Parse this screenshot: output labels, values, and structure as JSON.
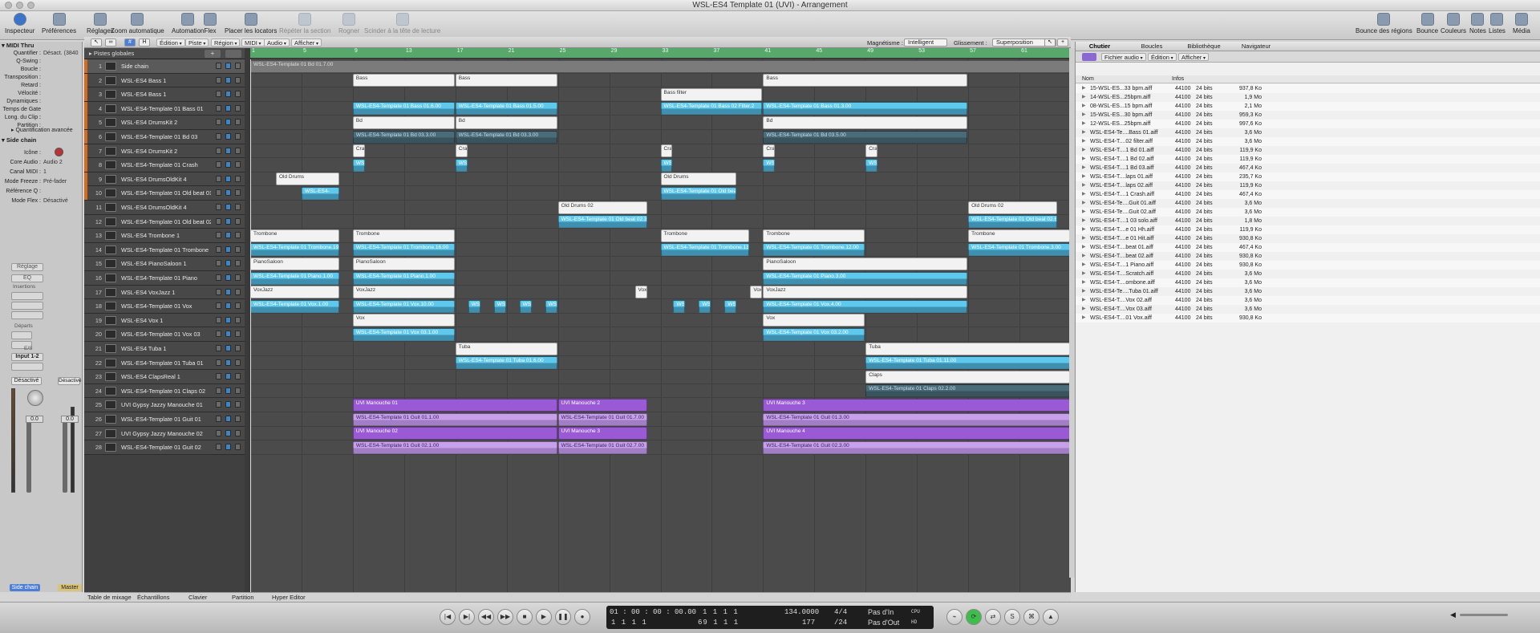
{
  "window": {
    "title": "WSL-ES4 Template 01 (UVI) - Arrangement"
  },
  "toolbar": {
    "left": [
      {
        "label": "Inspecteur",
        "icon": "info-icon"
      },
      {
        "label": "Préférences",
        "icon": "preferences-icon"
      },
      {
        "label": "Réglages",
        "icon": "settings-icon"
      },
      {
        "label": "Zoom automatique",
        "icon": "zoom-icon"
      },
      {
        "label": "Automation",
        "icon": "automation-icon"
      },
      {
        "label": "Flex",
        "icon": "flex-icon"
      },
      {
        "label": "Placer les locators",
        "icon": "locators-icon"
      },
      {
        "label": "Répéter la section",
        "icon": "repeat-icon"
      },
      {
        "label": "Rogner",
        "icon": "crop-icon"
      },
      {
        "label": "Scinder à la tête de lecture",
        "icon": "split-icon"
      }
    ],
    "right": [
      {
        "label": "Bounce des régions",
        "icon": "bounce-regions-icon"
      },
      {
        "label": "Bounce",
        "icon": "bounce-icon"
      },
      {
        "label": "Couleurs",
        "icon": "colors-icon"
      },
      {
        "label": "Notes",
        "icon": "notes-icon"
      },
      {
        "label": "Listes",
        "icon": "lists-icon"
      },
      {
        "label": "Média",
        "icon": "media-icon"
      }
    ]
  },
  "inspector": {
    "region_header": "MIDI Thru",
    "params": [
      {
        "k": "Quantifier :",
        "v": "Désact. (3840"
      },
      {
        "k": "Q-Swing :",
        "v": ""
      },
      {
        "k": "Boucle :",
        "v": ""
      },
      {
        "k": "Transposition :",
        "v": ""
      },
      {
        "k": "Retard :",
        "v": ""
      },
      {
        "k": "Vélocité :",
        "v": ""
      },
      {
        "k": "Dynamiques :",
        "v": ""
      },
      {
        "k": "Temps de Gate :",
        "v": ""
      },
      {
        "k": "Long. du Clip :",
        "v": ""
      },
      {
        "k": "Partition :",
        "v": ""
      }
    ],
    "advanced": "Quantification avancée",
    "track_header": "Side chain",
    "track_params": [
      {
        "k": "Icône :",
        "v": ""
      },
      {
        "k": "Core Audio :",
        "v": "Audio 2"
      },
      {
        "k": "Canal MIDI :",
        "v": "1"
      },
      {
        "k": "Mode Freeze :",
        "v": "Pré-fader"
      },
      {
        "k": "Référence Q :",
        "v": ""
      },
      {
        "k": "Mode Flex :",
        "v": "Désactivé"
      }
    ],
    "strip": {
      "reglage": "Réglage",
      "eq": "EQ",
      "insertions": "Insertions",
      "departs": "Départs",
      "es": "E/S",
      "input": "Input 1-2",
      "desactive": "Désactivé",
      "desactive2": "Désactivé",
      "vol1": "0.0",
      "vol2": "0.0",
      "name1": "Side chain",
      "name2": "Master"
    }
  },
  "arrange_menu": {
    "edition": "Édition",
    "piste": "Piste",
    "region": "Région",
    "midi": "MIDI",
    "audio": "Audio",
    "afficher": "Afficher",
    "magnetisme_label": "Magnétisme :",
    "magnetisme": "Intelligent",
    "glissement_label": "Glissement :",
    "glissement": "Superposition"
  },
  "global_tracks": "Pistes globales",
  "ruler": [
    "1",
    "5",
    "9",
    "13",
    "17",
    "21",
    "25",
    "29",
    "33",
    "37",
    "41",
    "45",
    "49",
    "53",
    "57",
    "61"
  ],
  "tracks": [
    {
      "n": "1",
      "name": "Side chain"
    },
    {
      "n": "2",
      "name": "WSL-ES4 Bass 1"
    },
    {
      "n": "3",
      "name": "WSL-ES4 Bass 1"
    },
    {
      "n": "4",
      "name": "WSL-ES4-Template 01 Bass 01"
    },
    {
      "n": "5",
      "name": "WSL-ES4 DrumsKit 2"
    },
    {
      "n": "6",
      "name": "WSL-ES4-Template 01 Bd 03"
    },
    {
      "n": "7",
      "name": "WSL-ES4 DrumsKit 2"
    },
    {
      "n": "8",
      "name": "WSL-ES4-Template 01 Crash"
    },
    {
      "n": "9",
      "name": "WSL-ES4 DrumsOldKit 4"
    },
    {
      "n": "10",
      "name": "WSL-ES4-Template 01 Old beat 01"
    },
    {
      "n": "11",
      "name": "WSL-ES4 DrumsOldKit 4"
    },
    {
      "n": "12",
      "name": "WSL-ES4-Template 01 Old beat 02"
    },
    {
      "n": "13",
      "name": "WSL-ES4 Trombone 1"
    },
    {
      "n": "14",
      "name": "WSL-ES4-Template 01 Trombone"
    },
    {
      "n": "15",
      "name": "WSL-ES4 PianoSaloon 1"
    },
    {
      "n": "16",
      "name": "WSL-ES4-Template 01 Piano"
    },
    {
      "n": "17",
      "name": "WSL-ES4 VoxJazz 1"
    },
    {
      "n": "18",
      "name": "WSL-ES4-Template 01 Vox"
    },
    {
      "n": "19",
      "name": "WSL-ES4 Vox 1"
    },
    {
      "n": "20",
      "name": "WSL-ES4-Template 01 Vox 03"
    },
    {
      "n": "21",
      "name": "WSL-ES4 Tuba 1"
    },
    {
      "n": "22",
      "name": "WSL-ES4-Template 01 Tuba 01"
    },
    {
      "n": "23",
      "name": "WSL-ES4 ClapsReal 1"
    },
    {
      "n": "24",
      "name": "WSL-ES4-Template 01 Claps 02"
    },
    {
      "n": "25",
      "name": "UVI Gypsy Jazzy Manouche 01"
    },
    {
      "n": "26",
      "name": "WSL-ES4-Template 01 Guit 01"
    },
    {
      "n": "27",
      "name": "UVI Gypsy Jazzy Manouche 02"
    },
    {
      "n": "28",
      "name": "WSL-ES4-Template 01 Guit 02"
    }
  ],
  "regions": [
    {
      "row": 0,
      "start": 1,
      "end": 65,
      "c": "wd",
      "t": "WSL-ES4-Template 01 Bd 01.7.00"
    },
    {
      "row": 1,
      "start": 9,
      "end": 17,
      "c": "w",
      "t": "Bass"
    },
    {
      "row": 1,
      "start": 17,
      "end": 25,
      "c": "w",
      "t": "Bass"
    },
    {
      "row": 1,
      "start": 41,
      "end": 57,
      "c": "w",
      "t": "Bass"
    },
    {
      "row": 2,
      "start": 33,
      "end": 41,
      "c": "w",
      "t": "Bass filter"
    },
    {
      "row": 3,
      "start": 9,
      "end": 17,
      "c": "b",
      "t": "WSL-ES4-Template 01 Bass 01.6.00"
    },
    {
      "row": 3,
      "start": 17,
      "end": 25,
      "c": "b",
      "t": "WSL-ES4-Template 01 Bass 01.5.00"
    },
    {
      "row": 3,
      "start": 33,
      "end": 41,
      "c": "b",
      "t": "WSL-ES4-Template 01 Bass 02 Filter.2"
    },
    {
      "row": 3,
      "start": 41,
      "end": 57,
      "c": "b",
      "t": "WSL-ES4-Template 01 Bass 01.3.00"
    },
    {
      "row": 4,
      "start": 9,
      "end": 17,
      "c": "w",
      "t": "Bd"
    },
    {
      "row": 4,
      "start": 17,
      "end": 25,
      "c": "w",
      "t": "Bd"
    },
    {
      "row": 4,
      "start": 41,
      "end": 57,
      "c": "w",
      "t": "Bd"
    },
    {
      "row": 5,
      "start": 9,
      "end": 17,
      "c": "bd",
      "t": "WSL-ES4-Template 01 Bd 03.3.00"
    },
    {
      "row": 5,
      "start": 17,
      "end": 25,
      "c": "bd",
      "t": "WSL-ES4-Template 01 Bd 03.3.00"
    },
    {
      "row": 5,
      "start": 41,
      "end": 57,
      "c": "bd",
      "t": "WSL-ES4-Template 01 Bd 03.5.00"
    },
    {
      "row": 6,
      "start": 9,
      "end": 10,
      "c": "w",
      "t": "Cras"
    },
    {
      "row": 6,
      "start": 17,
      "end": 18,
      "c": "w",
      "t": "Cras"
    },
    {
      "row": 6,
      "start": 33,
      "end": 34,
      "c": "w",
      "t": "Cras"
    },
    {
      "row": 6,
      "start": 41,
      "end": 42,
      "c": "w",
      "t": "Cras"
    },
    {
      "row": 6,
      "start": 49,
      "end": 50,
      "c": "w",
      "t": "Cras"
    },
    {
      "row": 7,
      "start": 9,
      "end": 10,
      "c": "b",
      "t": "WSL"
    },
    {
      "row": 7,
      "start": 17,
      "end": 18,
      "c": "b",
      "t": "WSL"
    },
    {
      "row": 7,
      "start": 33,
      "end": 34,
      "c": "b",
      "t": "WSL"
    },
    {
      "row": 7,
      "start": 41,
      "end": 42,
      "c": "b",
      "t": "WSL"
    },
    {
      "row": 7,
      "start": 49,
      "end": 50,
      "c": "b",
      "t": "WSL"
    },
    {
      "row": 8,
      "start": 3,
      "end": 8,
      "c": "w",
      "t": "Old Drums"
    },
    {
      "row": 8,
      "start": 33,
      "end": 39,
      "c": "w",
      "t": "Old Drums"
    },
    {
      "row": 9,
      "start": 5,
      "end": 8,
      "c": "b",
      "t": "WSL-ES4-"
    },
    {
      "row": 9,
      "start": 33,
      "end": 39,
      "c": "b",
      "t": "WSL-ES4-Template 01 Old beat"
    },
    {
      "row": 10,
      "start": 25,
      "end": 32,
      "c": "w",
      "t": "Old Drums 02"
    },
    {
      "row": 10,
      "start": 57,
      "end": 64,
      "c": "w",
      "t": "Old Drums 02"
    },
    {
      "row": 11,
      "start": 25,
      "end": 32,
      "c": "b",
      "t": "WSL-ES4-Template 01 Old beat 02.3"
    },
    {
      "row": 11,
      "start": 57,
      "end": 64,
      "c": "b",
      "t": "WSL-ES4-Template 01 Old beat 02.6"
    },
    {
      "row": 12,
      "start": 1,
      "end": 8,
      "c": "w",
      "t": "Trombone"
    },
    {
      "row": 12,
      "start": 9,
      "end": 17,
      "c": "w",
      "t": "Trombone"
    },
    {
      "row": 12,
      "start": 33,
      "end": 40,
      "c": "w",
      "t": "Trombone"
    },
    {
      "row": 12,
      "start": 41,
      "end": 49,
      "c": "w",
      "t": "Trombone"
    },
    {
      "row": 12,
      "start": 57,
      "end": 65,
      "c": "w",
      "t": "Trombone"
    },
    {
      "row": 13,
      "start": 1,
      "end": 8,
      "c": "b",
      "t": "WSL-ES4-Template 01 Trombone.19"
    },
    {
      "row": 13,
      "start": 9,
      "end": 17,
      "c": "b",
      "t": "WSL-ES4-Template 01 Trombone.16.00"
    },
    {
      "row": 13,
      "start": 33,
      "end": 40,
      "c": "b",
      "t": "WSL-ES4-Template 01 Trombone.13"
    },
    {
      "row": 13,
      "start": 41,
      "end": 49,
      "c": "b",
      "t": "WSL-ES4-Template 01 Trombone.12.00"
    },
    {
      "row": 13,
      "start": 57,
      "end": 65,
      "c": "b",
      "t": "WSL-ES4-Template 01 Trombone.3.00"
    },
    {
      "row": 14,
      "start": 1,
      "end": 8,
      "c": "w",
      "t": "PianoSaloon"
    },
    {
      "row": 14,
      "start": 9,
      "end": 17,
      "c": "w",
      "t": "PianoSaloon"
    },
    {
      "row": 14,
      "start": 41,
      "end": 57,
      "c": "w",
      "t": "PianoSaloon"
    },
    {
      "row": 15,
      "start": 1,
      "end": 8,
      "c": "b",
      "t": "WSL-ES4-Template 01 Piano.1.00"
    },
    {
      "row": 15,
      "start": 9,
      "end": 17,
      "c": "b",
      "t": "WSL-ES4-Template 01 Piano.1.00"
    },
    {
      "row": 15,
      "start": 41,
      "end": 57,
      "c": "b",
      "t": "WSL-ES4-Template 01 Piano.3.00"
    },
    {
      "row": 16,
      "start": 1,
      "end": 8,
      "c": "w",
      "t": "VoxJazz"
    },
    {
      "row": 16,
      "start": 9,
      "end": 17,
      "c": "w",
      "t": "VoxJazz"
    },
    {
      "row": 16,
      "start": 31,
      "end": 32,
      "c": "w",
      "t": "Vox"
    },
    {
      "row": 16,
      "start": 40,
      "end": 41,
      "c": "w",
      "t": "Vox"
    },
    {
      "row": 16,
      "start": 41,
      "end": 57,
      "c": "w",
      "t": "VoxJazz"
    },
    {
      "row": 17,
      "start": 1,
      "end": 8,
      "c": "b",
      "t": "WSL-ES4-Template 01 Vox.1.00"
    },
    {
      "row": 17,
      "start": 9,
      "end": 17,
      "c": "b",
      "t": "WSL-ES4-Template 01 Vox.10.00"
    },
    {
      "row": 17,
      "start": 18,
      "end": 19,
      "c": "b",
      "t": "WSL"
    },
    {
      "row": 17,
      "start": 20,
      "end": 21,
      "c": "b",
      "t": "WSL"
    },
    {
      "row": 17,
      "start": 22,
      "end": 23,
      "c": "b",
      "t": "WSL"
    },
    {
      "row": 17,
      "start": 24,
      "end": 25,
      "c": "b",
      "t": "WSL"
    },
    {
      "row": 17,
      "start": 34,
      "end": 35,
      "c": "b",
      "t": "WSL"
    },
    {
      "row": 17,
      "start": 36,
      "end": 37,
      "c": "b",
      "t": "WSL"
    },
    {
      "row": 17,
      "start": 38,
      "end": 39,
      "c": "b",
      "t": "WSL"
    },
    {
      "row": 17,
      "start": 41,
      "end": 57,
      "c": "b",
      "t": "WSL-ES4-Template 01 Vox.4.00"
    },
    {
      "row": 18,
      "start": 9,
      "end": 17,
      "c": "w",
      "t": "Vox"
    },
    {
      "row": 18,
      "start": 41,
      "end": 49,
      "c": "w",
      "t": "Vox"
    },
    {
      "row": 19,
      "start": 9,
      "end": 17,
      "c": "b",
      "t": "WSL-ES4-Template 01 Vox 03.1.00"
    },
    {
      "row": 19,
      "start": 41,
      "end": 49,
      "c": "b",
      "t": "WSL-ES4-Template 01 Vox 03.2.00"
    },
    {
      "row": 20,
      "start": 17,
      "end": 25,
      "c": "w",
      "t": "Tuba"
    },
    {
      "row": 20,
      "start": 49,
      "end": 65,
      "c": "w",
      "t": "Tuba"
    },
    {
      "row": 21,
      "start": 17,
      "end": 25,
      "c": "b",
      "t": "WSL-ES4-Template 01 Tuba 01.6.00"
    },
    {
      "row": 21,
      "start": 49,
      "end": 65,
      "c": "b",
      "t": "WSL-ES4-Template 01 Tuba 01.11.00"
    },
    {
      "row": 22,
      "start": 49,
      "end": 65,
      "c": "w",
      "t": "Claps"
    },
    {
      "row": 23,
      "start": 49,
      "end": 65,
      "c": "bd",
      "t": "WSL-ES4-Template 01 Claps 02.2.00"
    },
    {
      "row": 24,
      "start": 9,
      "end": 25,
      "c": "p",
      "t": "UVI Manouche 01"
    },
    {
      "row": 24,
      "start": 25,
      "end": 32,
      "c": "p",
      "t": "UVI Manouche 2"
    },
    {
      "row": 24,
      "start": 41,
      "end": 65,
      "c": "p",
      "t": "UVI Manouche 3"
    },
    {
      "row": 25,
      "start": 9,
      "end": 25,
      "c": "pl",
      "t": "WSL-ES4-Template 01 Guit 01.1.00"
    },
    {
      "row": 25,
      "start": 25,
      "end": 32,
      "c": "pl",
      "t": "WSL-ES4-Template 01 Guit 01.7.00"
    },
    {
      "row": 25,
      "start": 41,
      "end": 65,
      "c": "pl",
      "t": "WSL-ES4-Template 01 Guit 01.3.00"
    },
    {
      "row": 26,
      "start": 9,
      "end": 25,
      "c": "p",
      "t": "UVI Manouche 02"
    },
    {
      "row": 26,
      "start": 25,
      "end": 32,
      "c": "p",
      "t": "UVI Manouche 3"
    },
    {
      "row": 26,
      "start": 41,
      "end": 65,
      "c": "p",
      "t": "UVI Manouche 4"
    },
    {
      "row": 27,
      "start": 9,
      "end": 25,
      "c": "pl",
      "t": "WSL-ES4-Template 01 Guit 02.1.00"
    },
    {
      "row": 27,
      "start": 25,
      "end": 32,
      "c": "pl",
      "t": "WSL-ES4-Template 01 Guit 02.7.00"
    },
    {
      "row": 27,
      "start": 41,
      "end": 65,
      "c": "pl",
      "t": "WSL-ES4-Template 01 Guit 02.3.00"
    }
  ],
  "bottom_tabs": [
    "Table de mixage",
    "Échantillons",
    "Clavier",
    "Partition",
    "Hyper Editor"
  ],
  "browser": {
    "tabs": [
      "Chutier",
      "Boucles",
      "Bibliothèque",
      "Navigateur"
    ],
    "menus": [
      "Fichier audio",
      "Édition",
      "Afficher"
    ],
    "col_name": "Nom",
    "col_info": "Infos",
    "files": [
      {
        "n": "15-WSL-ES...33 bpm.aiff",
        "i": "44100",
        "b": "24 bits",
        "k": "937,8 Ko"
      },
      {
        "n": "14-WSL-ES...25bpm.aiff",
        "i": "44100",
        "b": "24 bits",
        "k": "1,9 Mo"
      },
      {
        "n": "08-WSL-ES...15 bpm.aiff",
        "i": "44100",
        "b": "24 bits",
        "k": "2,1 Mo"
      },
      {
        "n": "15-WSL-ES...30 bpm.aiff",
        "i": "44100",
        "b": "24 bits",
        "k": "959,3 Ko"
      },
      {
        "n": "12-WSL-ES...25bpm.aiff",
        "i": "44100",
        "b": "24 bits",
        "k": "997,6 Ko"
      },
      {
        "n": "WSL-ES4-Te....Bass 01.aiff",
        "i": "44100",
        "b": "24 bits",
        "k": "3,6 Mo"
      },
      {
        "n": "WSL-ES4-T....02 filter.aiff",
        "i": "44100",
        "b": "24 bits",
        "k": "3,6 Mo"
      },
      {
        "n": "WSL-ES4-T....1 Bd 01.aiff",
        "i": "44100",
        "b": "24 bits",
        "k": "119,9 Ko"
      },
      {
        "n": "WSL-ES4-T....1 Bd 02.aiff",
        "i": "44100",
        "b": "24 bits",
        "k": "119,9 Ko"
      },
      {
        "n": "WSL-ES4-T....1 Bd 03.aiff",
        "i": "44100",
        "b": "24 bits",
        "k": "467,4 Ko"
      },
      {
        "n": "WSL-ES4-T....laps 01.aiff",
        "i": "44100",
        "b": "24 bits",
        "k": "235,7 Ko"
      },
      {
        "n": "WSL-ES4-T....laps 02.aiff",
        "i": "44100",
        "b": "24 bits",
        "k": "119,9 Ko"
      },
      {
        "n": "WSL-ES4-T....1 Crash.aiff",
        "i": "44100",
        "b": "24 bits",
        "k": "467,4 Ko"
      },
      {
        "n": "WSL-ES4-Te....Guit 01.aiff",
        "i": "44100",
        "b": "24 bits",
        "k": "3,6 Mo"
      },
      {
        "n": "WSL-ES4-Te....Guit 02.aiff",
        "i": "44100",
        "b": "24 bits",
        "k": "3,6 Mo"
      },
      {
        "n": "WSL-ES4-T....1 03 solo.aiff",
        "i": "44100",
        "b": "24 bits",
        "k": "1,8 Mo"
      },
      {
        "n": "WSL-ES4-T....e 01 Hh.aiff",
        "i": "44100",
        "b": "24 bits",
        "k": "119,9 Ko"
      },
      {
        "n": "WSL-ES4-T....e 01 Hit.aiff",
        "i": "44100",
        "b": "24 bits",
        "k": "930,8 Ko"
      },
      {
        "n": "WSL-ES4-T....beat 01.aiff",
        "i": "44100",
        "b": "24 bits",
        "k": "467,4 Ko"
      },
      {
        "n": "WSL-ES4-T....beat 02.aiff",
        "i": "44100",
        "b": "24 bits",
        "k": "930,8 Ko"
      },
      {
        "n": "WSL-ES4-T....1 Piano.aiff",
        "i": "44100",
        "b": "24 bits",
        "k": "930,8 Ko"
      },
      {
        "n": "WSL-ES4-T....Scratch.aiff",
        "i": "44100",
        "b": "24 bits",
        "k": "3,6 Mo"
      },
      {
        "n": "WSL-ES4-T....ombone.aiff",
        "i": "44100",
        "b": "24 bits",
        "k": "3,6 Mo"
      },
      {
        "n": "WSL-ES4-Te....Tuba 01.aiff",
        "i": "44100",
        "b": "24 bits",
        "k": "3,6 Mo"
      },
      {
        "n": "WSL-ES4-T....Vox 02.aiff",
        "i": "44100",
        "b": "24 bits",
        "k": "3,6 Mo"
      },
      {
        "n": "WSL-ES4-T....Vox 03.aiff",
        "i": "44100",
        "b": "24 bits",
        "k": "3,6 Mo"
      },
      {
        "n": "WSL-ES4-T....01 Vox.aiff",
        "i": "44100",
        "b": "24 bits",
        "k": "930,8 Ko"
      }
    ]
  },
  "transport": {
    "time": "01 : 00 : 00 : 00.00",
    "pos1": "1    1    1    1",
    "pos2": "1    1    1    1",
    "loc1": "1    1    1    1",
    "loc2": "69    1    1    1",
    "tempo": "134.0000",
    "tempo2": "177",
    "sig": "4/4",
    "div": "/24",
    "in": "Pas d'In",
    "out": "Pas d'Out",
    "cpu": "CPU",
    "hd": "HD"
  }
}
